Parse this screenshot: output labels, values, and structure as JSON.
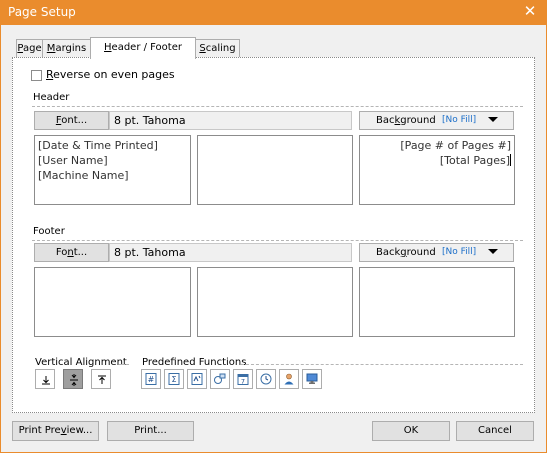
{
  "window": {
    "title": "Page Setup",
    "close_glyph": "✕"
  },
  "tabs": [
    {
      "pre": "",
      "acc": "P",
      "post": "age"
    },
    {
      "pre": "",
      "acc": "M",
      "post": "argins"
    },
    {
      "pre": "",
      "acc": "H",
      "post": "eader / Footer"
    },
    {
      "pre": "",
      "acc": "S",
      "post": "caling"
    }
  ],
  "active_tab": "Header / Footer",
  "reverse_even": {
    "pre": "",
    "acc": "R",
    "post": "everse on even pages",
    "checked": false
  },
  "header": {
    "label": "Header",
    "font_button": {
      "pre": "",
      "acc": "F",
      "post": "ont..."
    },
    "font_value": "8 pt. Tahoma",
    "background": {
      "pre": "Bac",
      "acc": "k",
      "post": "ground",
      "fill": "[No Fill]"
    },
    "left_lines": [
      "[Date & Time Printed]",
      "[User Name]",
      "[Machine Name]"
    ],
    "center_lines": [],
    "right_lines": [
      "[Page # of Pages #]",
      "[Total Pages]"
    ]
  },
  "footer": {
    "label": "Footer",
    "font_button": {
      "pre": "Fo",
      "acc": "n",
      "post": "t..."
    },
    "font_value": "8 pt. Tahoma",
    "background": {
      "pre": "Back",
      "acc": "g",
      "post": "round",
      "fill": "[No Fill]"
    }
  },
  "vertical_alignment": {
    "label": "Vertical Alignment",
    "selected": "center"
  },
  "predefined_functions": {
    "label": "Predefined Functions"
  },
  "buttons": {
    "print_preview": {
      "pre": "Print Pre",
      "acc": "v",
      "post": "iew..."
    },
    "print": "Print...",
    "ok": "OK",
    "cancel": "Cancel"
  },
  "colors": {
    "titlebar": "#ea8c2d",
    "link": "#1c6fc9",
    "selected_align": "#9f9f9f"
  }
}
